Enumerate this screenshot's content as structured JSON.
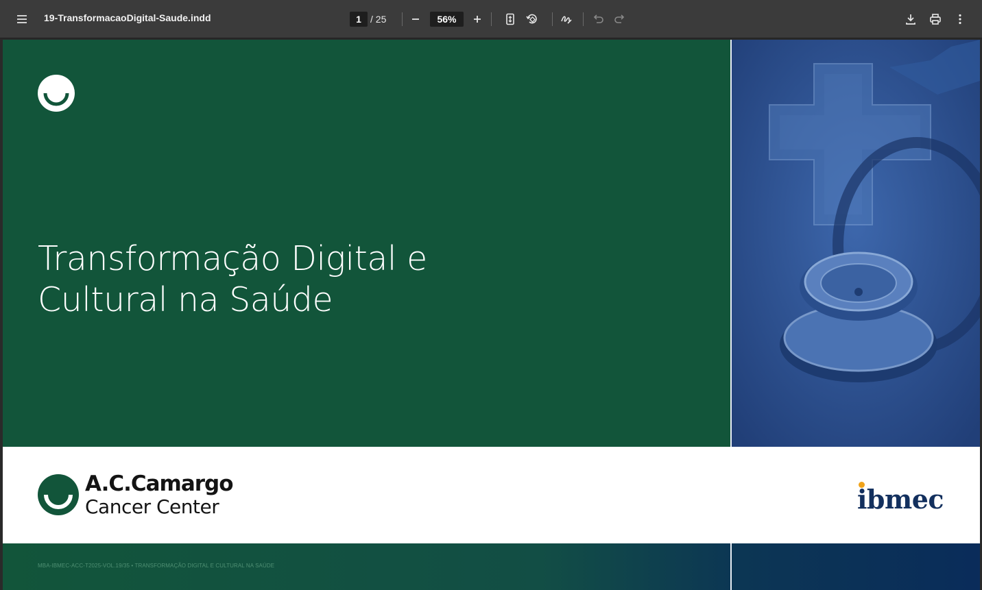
{
  "toolbar": {
    "menu_icon": "hamburger-menu-icon",
    "file_name": "19-TransformacaoDigital-Saude.indd",
    "current_page": "1",
    "page_total": "/ 25",
    "zoom": "56%",
    "icons": [
      "zoom-out-icon",
      "zoom-in-icon",
      "fit-page-icon",
      "rotate-icon",
      "draw-icon",
      "undo-icon",
      "redo-icon",
      "download-icon",
      "print-icon",
      "more-options-icon"
    ]
  },
  "document": {
    "title_line1": "Transformação Digital e",
    "title_line2": "Cultural na Saúde",
    "acc_name": "A.C.Camargo",
    "acc_sub": "Cancer Center",
    "ibmec": "ibmec",
    "footer_code": "MBA-IBMEC-ACC-T2025-VOL.19/35 • TRANSFORMAÇÃO DIGITAL E CULTURAL NA SAÚDE"
  },
  "colors": {
    "toolbar_bg": "#3b3b3b",
    "green": "#12553a",
    "blue": "#2b5497",
    "ibmec_navy": "#13305e",
    "ibmec_orange": "#f0a31b"
  }
}
